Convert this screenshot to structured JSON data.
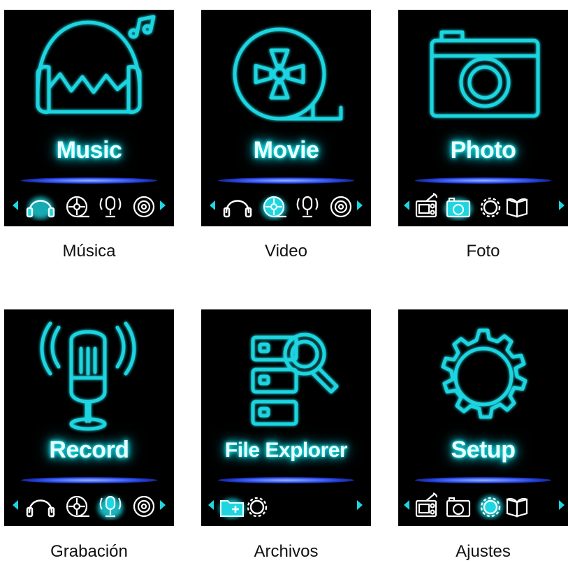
{
  "colors": {
    "neon": "#1fd5e0",
    "tile_bg": "#000000",
    "glow_bar": "#3556ff"
  },
  "tiles": [
    {
      "title": "Music",
      "caption": "Música",
      "icon": "headphones-icon"
    },
    {
      "title": "Movie",
      "caption": "Video",
      "icon": "film-reel-icon"
    },
    {
      "title": "Photo",
      "caption": "Foto",
      "icon": "camera-icon"
    },
    {
      "title": "Record",
      "caption": "Grabación",
      "icon": "microphone-icon"
    },
    {
      "title": "File Explorer",
      "caption": "Archivos",
      "icon": "file-search-icon"
    },
    {
      "title": "Setup",
      "caption": "Ajustes",
      "icon": "gear-icon"
    }
  ]
}
